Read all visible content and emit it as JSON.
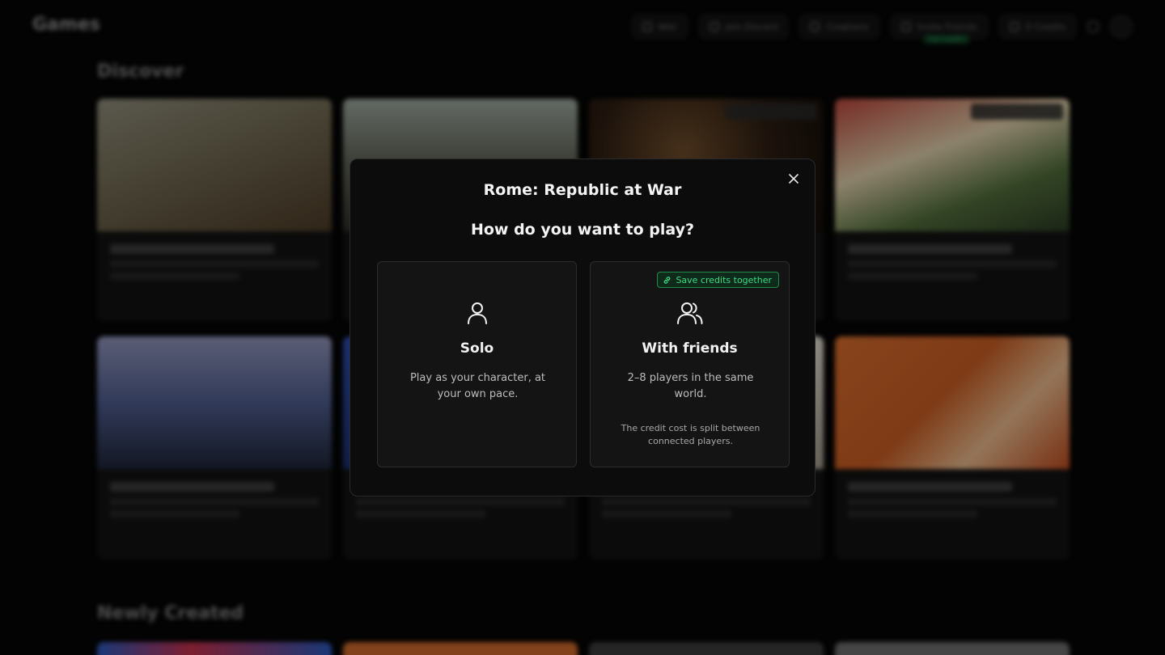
{
  "header": {
    "brand": "Games",
    "nav": [
      "Wiki",
      "Join Discord",
      "Creations",
      "Invite Friends",
      "0 Credits"
    ],
    "invite_tag": "Get credits"
  },
  "sections": {
    "discover": "Discover",
    "newly_created": "Newly Created"
  },
  "modal": {
    "title": "Rome: Republic at War",
    "question": "How do you want to play?",
    "close_label": "×",
    "solo": {
      "icon": "user-icon",
      "name": "Solo",
      "description": "Play as your character, at your own pace."
    },
    "friends": {
      "icon": "users-icon",
      "badge": "Save credits together",
      "badge_icon": "link-icon",
      "name": "With friends",
      "description": "2–8 players in the same world.",
      "note": "The credit cost is split between connected players."
    }
  },
  "colors": {
    "accent_green": "#3ddc84",
    "modal_bg": "#0c0c0c",
    "card_bg": "#141414"
  }
}
